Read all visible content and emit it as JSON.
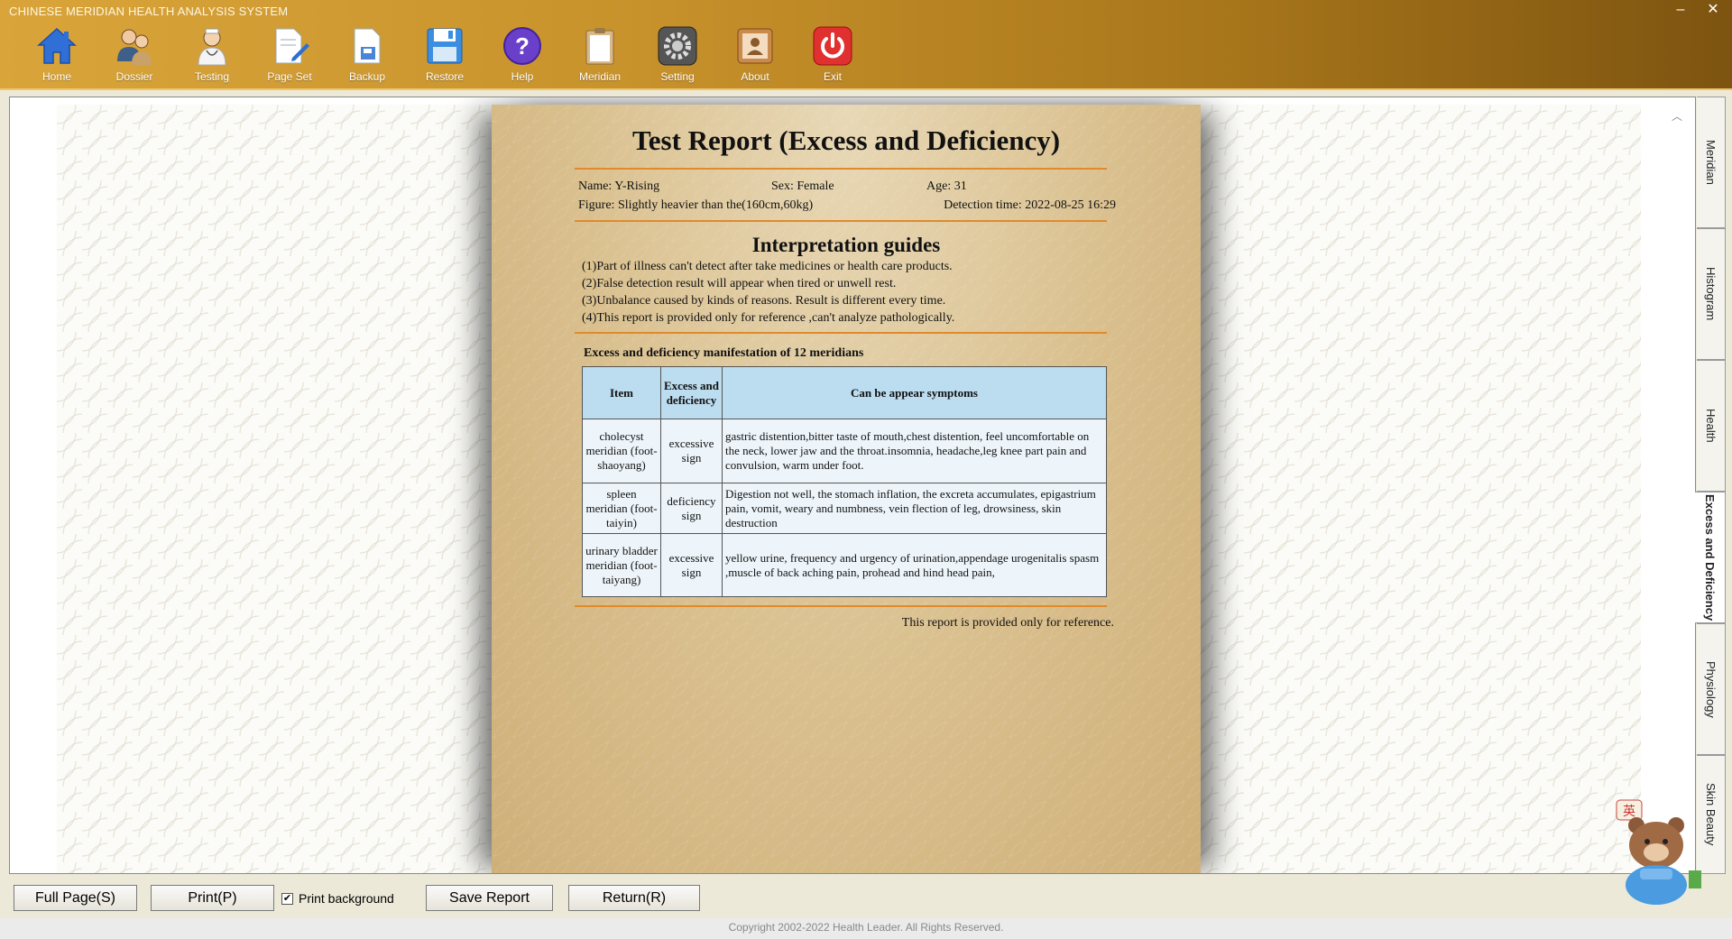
{
  "app": {
    "title": "CHINESE MERIDIAN HEALTH ANALYSIS SYSTEM"
  },
  "window_controls": {
    "minimize": "–",
    "close": "✕"
  },
  "toolbar": [
    {
      "label": "Home",
      "icon": "home-icon"
    },
    {
      "label": "Dossier",
      "icon": "users-icon"
    },
    {
      "label": "Testing",
      "icon": "doctor-icon"
    },
    {
      "label": "Page Set",
      "icon": "page-edit-icon"
    },
    {
      "label": "Backup",
      "icon": "backup-doc-icon"
    },
    {
      "label": "Restore",
      "icon": "floppy-disk-icon"
    },
    {
      "label": "Help",
      "icon": "help-icon"
    },
    {
      "label": "Meridian",
      "icon": "clipboard-icon"
    },
    {
      "label": "Setting",
      "icon": "gear-icon"
    },
    {
      "label": "About",
      "icon": "person-card-icon"
    },
    {
      "label": "Exit",
      "icon": "power-icon"
    }
  ],
  "report": {
    "title": "Test Report (Excess and Deficiency)",
    "name": "Name: Y-Rising",
    "sex": "Sex: Female",
    "age": "Age: 31",
    "figure": "Figure: Slightly heavier than the(160cm,60kg)",
    "detection_time": "Detection time: 2022-08-25 16:29",
    "guides_title": "Interpretation guides",
    "guides": [
      "(1)Part of illness can't detect after take medicines or health care products.",
      "(2)False detection result will appear when tired or unwell rest.",
      "(3)Unbalance caused by kinds of reasons. Result is different every time.",
      "(4)This report is provided only for reference ,can't analyze pathologically."
    ],
    "table_caption": "Excess and deficiency manifestation of 12 meridians",
    "columns": [
      "Item",
      "Excess and deficiency",
      "Can be appear symptoms"
    ],
    "rows": [
      {
        "item": "cholecyst meridian (foot-shaoyang)",
        "status": "excessive sign",
        "symptoms": "gastric distention,bitter taste of mouth,chest distention, feel uncomfortable on the neck, lower jaw and the throat.insomnia, headache,leg knee part pain and convulsion, warm under foot."
      },
      {
        "item": "spleen meridian (foot-taiyin)",
        "status": "deficiency sign",
        "symptoms": "Digestion not well, the stomach inflation, the excreta accumulates, epigastrium pain, vomit, weary and numbness, vein flection of leg, drowsiness, skin destruction"
      },
      {
        "item": "urinary bladder meridian (foot-taiyang)",
        "status": "excessive sign",
        "symptoms": "yellow urine, frequency and urgency of urination,appendage urogenitalis spasm ,muscle of back aching pain, prohead and hind head pain,"
      }
    ],
    "footnote": "This report is provided only for reference."
  },
  "side_tabs": [
    {
      "label": "Meridian",
      "active": false
    },
    {
      "label": "Histogram",
      "active": false
    },
    {
      "label": "Health",
      "active": false
    },
    {
      "label": "Excess and Deficiency",
      "active": true
    },
    {
      "label": "Physiology",
      "active": false
    },
    {
      "label": "Skin Beauty",
      "active": false
    }
  ],
  "buttons": {
    "full_page": "Full Page(S)",
    "print": "Print(P)",
    "print_background": "Print background",
    "print_background_checked": true,
    "save_report": "Save Report",
    "return": "Return(R)"
  },
  "mascot_badge": "英",
  "copyright": "Copyright 2002-2022 Health Leader.  All Rights Reserved."
}
